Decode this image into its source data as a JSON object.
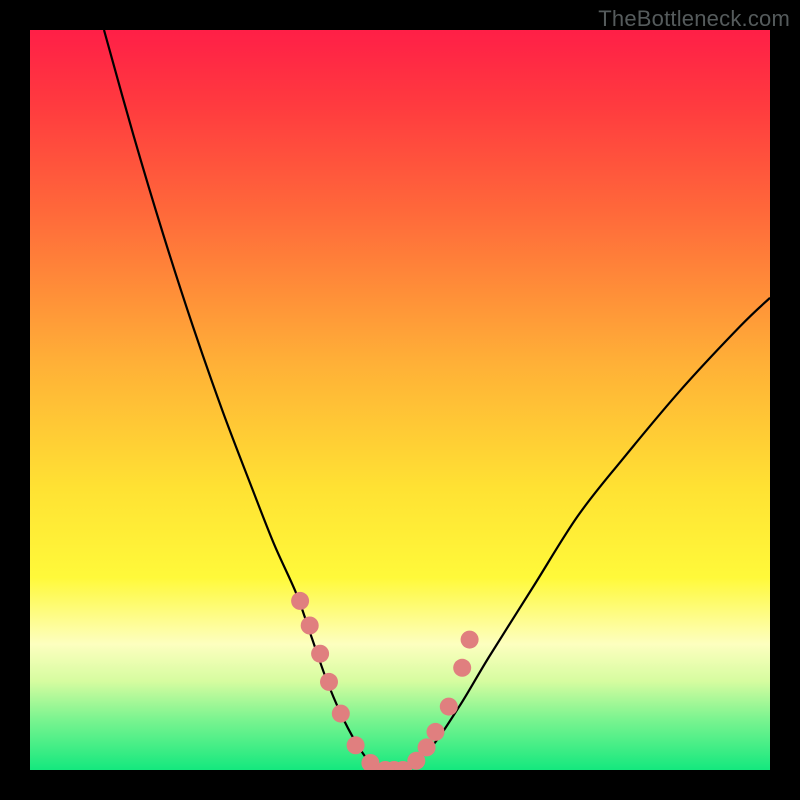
{
  "watermark": "TheBottleneck.com",
  "colors": {
    "frame": "#000000",
    "gradient_stops": [
      {
        "pct": 0,
        "hex": "#ff1f47"
      },
      {
        "pct": 10,
        "hex": "#ff3a3f"
      },
      {
        "pct": 25,
        "hex": "#ff6a3a"
      },
      {
        "pct": 45,
        "hex": "#ffb037"
      },
      {
        "pct": 62,
        "hex": "#ffe233"
      },
      {
        "pct": 74,
        "hex": "#fff93a"
      },
      {
        "pct": 83,
        "hex": "#fdffbf"
      },
      {
        "pct": 88,
        "hex": "#d6fca0"
      },
      {
        "pct": 93,
        "hex": "#7df490"
      },
      {
        "pct": 100,
        "hex": "#14e87e"
      }
    ],
    "curve": "#000000",
    "marker_fill": "#e07f7f",
    "marker_stroke": "#c95f5f"
  },
  "chart_data": {
    "type": "line",
    "title": "",
    "xlabel": "",
    "ylabel": "",
    "xlim": [
      0,
      100
    ],
    "ylim": [
      0,
      105
    ],
    "series": [
      {
        "name": "bottleneck-curve",
        "x": [
          10,
          14,
          18,
          22,
          26,
          30,
          33,
          36,
          38,
          40,
          42,
          44,
          46,
          48,
          50,
          54,
          58,
          62,
          68,
          74,
          80,
          88,
          96,
          100
        ],
        "y": [
          105,
          90,
          76,
          63,
          51,
          40,
          32,
          25,
          19,
          13,
          8,
          4,
          1,
          0,
          0,
          3,
          9,
          16,
          26,
          36,
          44,
          54,
          63,
          67
        ]
      }
    ],
    "markers": {
      "name": "highlighted-points",
      "x": [
        36.5,
        37.8,
        39.2,
        40.4,
        42.0,
        44.0,
        46.0,
        48.0,
        49.2,
        50.4,
        52.2,
        53.6,
        54.8,
        56.6,
        58.4,
        59.4
      ],
      "y": [
        24,
        20.5,
        16.5,
        12.5,
        8.0,
        3.5,
        1.0,
        0,
        0,
        0,
        1.3,
        3.2,
        5.4,
        9.0,
        14.5,
        18.5
      ]
    }
  }
}
